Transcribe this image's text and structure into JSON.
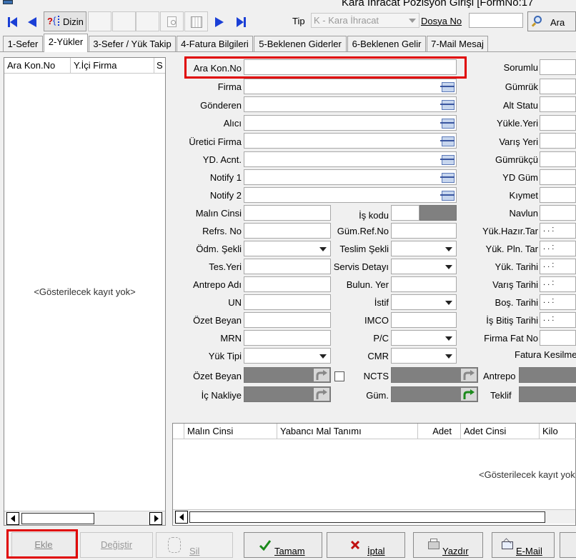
{
  "window": {
    "title": "Kara İhracat Pozisyon Girişi [FormNo:17"
  },
  "toolbar": {
    "dizin_label": "Dizin",
    "tip_label": "Tip",
    "tip_value": "K - Kara İhracat",
    "dosya_label": "Dosya No",
    "ara_label": "Ara"
  },
  "tabs": [
    "1-Sefer",
    "2-Yükler",
    "3-Sefer / Yük Takip",
    "4-Fatura Bilgileri",
    "5-Beklenen Giderler",
    "6-Beklenen Gelir",
    "7-Mail Mesaj"
  ],
  "left_list": {
    "columns": [
      "Ara Kon.No",
      "Y.İçi Firma",
      "S"
    ],
    "empty": "<Gösterilecek kayıt yok>"
  },
  "form": {
    "ara_kon_no": "Ara Kon.No",
    "firma": "Firma",
    "gonderen": "Gönderen",
    "alici": "Alıcı",
    "uretici": "Üretici Firma",
    "yd_acnt": "YD. Acnt.",
    "notify1": "Notify 1",
    "notify2": "Notify 2",
    "malin_cinsi": "Malın Cinsi",
    "refrs_no": "Refrs. No",
    "odm_sekli": "Ödm. Şekli",
    "tes_yeri": "Tes.Yeri",
    "antrepo_adi": "Antrepo Adı",
    "un": "UN",
    "ozet_beyan": "Özet Beyan",
    "mrn": "MRN",
    "yuk_tipi": "Yük Tipi",
    "ozet_beyan2": "Özet Beyan",
    "ic_nakliye": "İç Nakliye",
    "is_kodu": "İş kodu",
    "gum_ref_no": "Güm.Ref.No",
    "teslim_sekli": "Teslim Şekli",
    "servis_detayi": "Servis Detayı",
    "bulun_yer": "Bulun. Yer",
    "istif": "İstif",
    "imco": "IMCO",
    "pc": "P/C",
    "cmr": "CMR",
    "ncts": "NCTS",
    "gum": "Güm.",
    "sorumlu": "Sorumlu",
    "gumruk": "Gümrük",
    "alt_statu": "Alt Statu",
    "yukle_yeri": "Yükle.Yeri",
    "varis_yeri": "Varış Yeri",
    "gumrukcu": "Gümrükçü",
    "yd_gum": "YD Güm",
    "kiymet": "Kıymet",
    "navlun": "Navlun",
    "yuk_hazir_tar": "Yük.Hazır.Tar",
    "yuk_pln_tar": "Yük. Pln. Tar",
    "yuk_tarihi": "Yük. Tarihi",
    "varis_tarihi": "Varış Tarihi",
    "bos_tarihi": "Boş. Tarihi",
    "is_bitis_tarihi": "İş Bitiş Tarihi",
    "firma_fat_no": "Firma Fat No",
    "fatura_kesilme": "Fatura Kesilme",
    "antrepo": "Antrepo",
    "teklif": "Teklif",
    "date_mask": ". .   :"
  },
  "grid": {
    "columns": [
      "Malın Cinsi",
      "Yabancı Mal Tanımı",
      "Adet",
      "Adet Cinsi",
      "Kilo"
    ],
    "empty": "<Gösterilecek kayıt yok"
  },
  "buttons": {
    "ekle": "Ekle",
    "degistir": "Değiştir",
    "sil": "Sil",
    "tamam": "Tamam",
    "iptal": "İptal",
    "yazdir": "Yazdır",
    "email": "E-Mail"
  },
  "colors": {
    "highlight": "#e00000",
    "nav_blue": "#1a3fd6",
    "disabled_field": "#808080"
  }
}
